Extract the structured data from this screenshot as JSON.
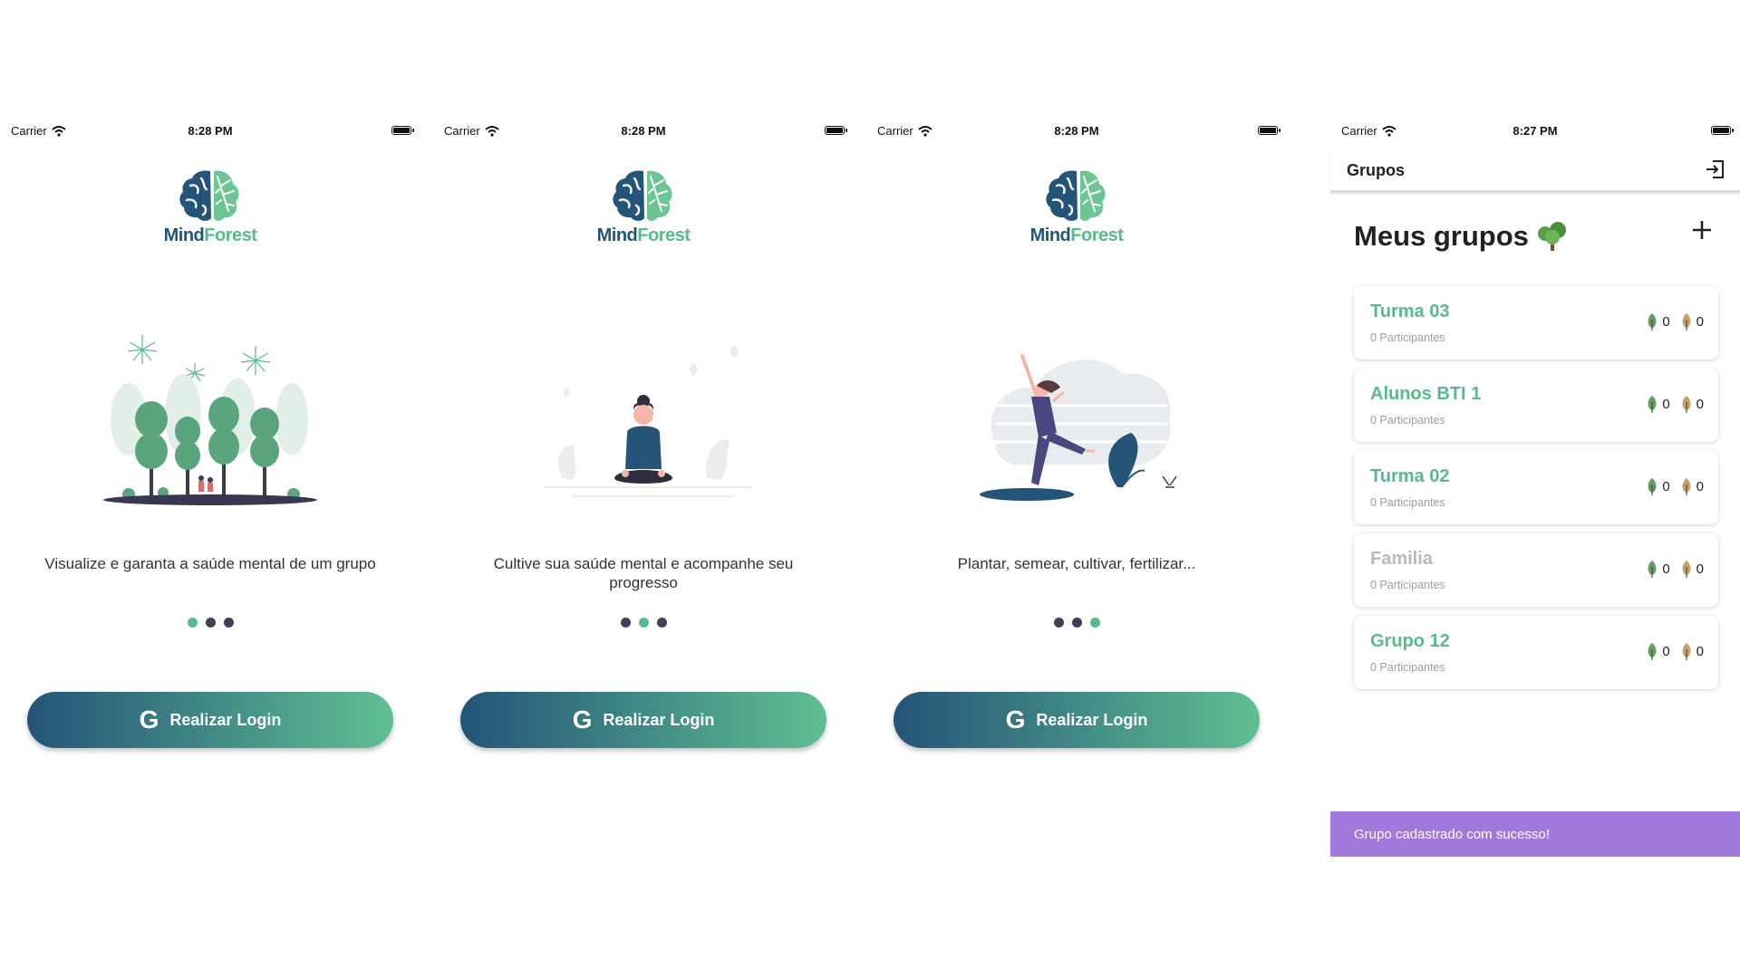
{
  "status": {
    "carrier": "Carrier",
    "battery_icon": "battery-icon",
    "wifi_icon": "wifi-icon"
  },
  "logo": {
    "mind": "Mind",
    "forest": "Forest",
    "icon": "brain-leaf-icon"
  },
  "onboarding": [
    {
      "time": "8:28 PM",
      "caption": "Visualize e garanta a saúde mental de um grupo",
      "active_dot": 0,
      "illustration": "trees-fireworks-illustration"
    },
    {
      "time": "8:28 PM",
      "caption": "Cultive sua saúde mental e acompanhe seu progresso",
      "active_dot": 1,
      "illustration": "meditation-illustration"
    },
    {
      "time": "8:28 PM",
      "caption": "Plantar, semear, cultivar, fertilizar...",
      "active_dot": 2,
      "illustration": "dancing-woman-illustration"
    }
  ],
  "login_button": {
    "label": "Realizar Login",
    "icon": "google-icon",
    "glyph": "G"
  },
  "groups_screen": {
    "time": "8:27 PM",
    "appbar_title": "Grupos",
    "heading": "Meus grupos",
    "add_icon": "plus-icon",
    "exit_icon": "exit-icon",
    "groups": [
      {
        "name": "Turma 03",
        "participants": "0 Participantes",
        "healthy": "0",
        "dry": "0",
        "muted": false
      },
      {
        "name": "Alunos BTI 1",
        "participants": "0 Participantes",
        "healthy": "0",
        "dry": "0",
        "muted": false
      },
      {
        "name": "Turma 02",
        "participants": "0 Participantes",
        "healthy": "0",
        "dry": "0",
        "muted": false
      },
      {
        "name": "Familia",
        "participants": "0 Participantes",
        "healthy": "0",
        "dry": "0",
        "muted": true
      },
      {
        "name": "Grupo 12",
        "participants": "0 Participantes",
        "healthy": "0",
        "dry": "0",
        "muted": false
      }
    ],
    "snackbar": "Grupo cadastrado com sucesso!"
  },
  "colors": {
    "green": "#58b98c",
    "navy": "#245478",
    "snackbar": "#a178dc",
    "dot": "#3d4155"
  }
}
